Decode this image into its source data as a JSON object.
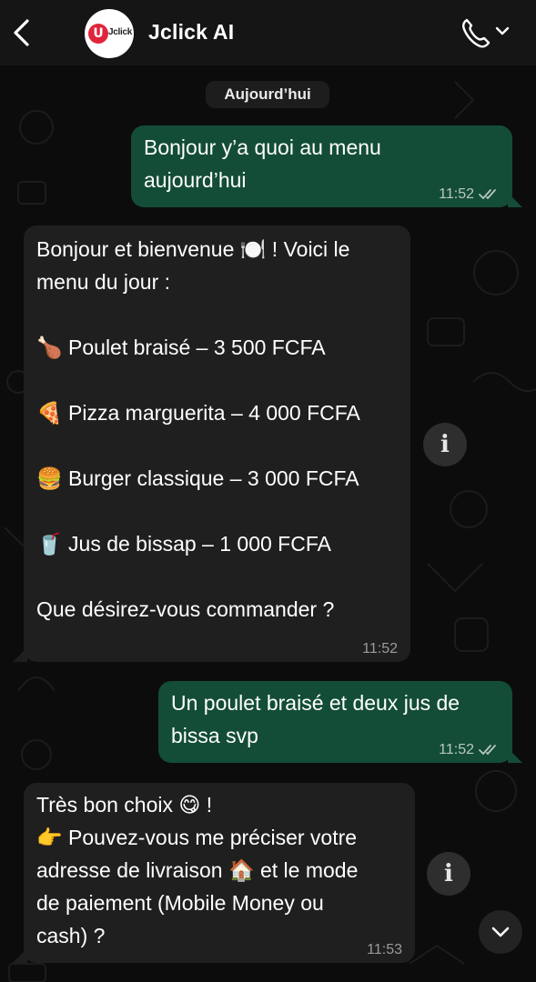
{
  "header": {
    "contact_name": "Jclick AI",
    "avatar_logo_text": "Jclick",
    "back_icon": "chevron-left-icon",
    "call_icon": "phone-icon"
  },
  "date_chip": "Aujourd’hui",
  "messages": [
    {
      "direction": "out",
      "text": "Bonjour y’a quoi au menu\naujourd’hui",
      "time": "11:52",
      "status": "read"
    },
    {
      "direction": "in",
      "text": "Bonjour et bienvenue 🍽️ ! Voici le\nmenu du jour :\n\n🍗 Poulet braisé – 3 500 FCFA\n\n🍕 Pizza marguerita – 4 000 FCFA\n\n🍔 Burger classique – 3 000 FCFA\n\n🥤 Jus de bissap – 1 000 FCFA\n\nQue désirez-vous commander ?",
      "time": "11:52"
    },
    {
      "direction": "out",
      "text": "Un poulet braisé et deux jus de\nbissa svp",
      "time": "11:52",
      "status": "read"
    },
    {
      "direction": "in",
      "text": "Très bon choix 😋 !\n👉 Pouvez-vous me préciser votre\nadresse de livraison 🏠 et le mode\nde paiement (Mobile Money ou\ncash) ?",
      "time": "11:53"
    }
  ],
  "colors": {
    "header_bg": "#151515",
    "outgoing_bubble": "#144d37",
    "incoming_bubble": "#1f1f1f",
    "wallpaper": "#0c0c0c"
  }
}
